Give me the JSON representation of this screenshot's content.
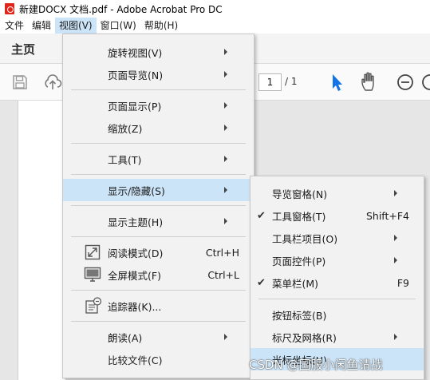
{
  "title_bar": {
    "title": "新建DOCX 文档.pdf - Adobe Acrobat Pro DC",
    "icon": "acrobat-pdf-icon"
  },
  "menubar": [
    {
      "label": "文件"
    },
    {
      "label": "编辑"
    },
    {
      "label": "视图(V)",
      "active": true
    },
    {
      "label": "窗口(W)"
    },
    {
      "label": "帮助(H)"
    }
  ],
  "tab": {
    "home": "主页"
  },
  "toolbar": {
    "page_current": "1",
    "page_total": "/ 1",
    "icons": [
      "save-icon",
      "upload-icon",
      "select-pointer-icon",
      "hand-tool-icon",
      "zoom-out-icon"
    ]
  },
  "view_menu": {
    "items": [
      {
        "label": "旋转视图(V)",
        "submenu": true
      },
      {
        "label": "页面导览(N)",
        "submenu": true
      },
      {
        "label": "页面显示(P)",
        "submenu": true
      },
      {
        "label": "缩放(Z)",
        "submenu": true
      },
      {
        "label": "工具(T)",
        "submenu": true
      },
      {
        "label": "显示/隐藏(S)",
        "submenu": true,
        "highlighted": true
      },
      {
        "label": "显示主题(H)",
        "submenu": true
      },
      {
        "label": "阅读模式(D)",
        "shortcut": "Ctrl+H",
        "icon": "read-mode-icon"
      },
      {
        "label": "全屏模式(F)",
        "shortcut": "Ctrl+L",
        "icon": "fullscreen-icon"
      },
      {
        "label": "追踪器(K)...",
        "icon": "tracker-icon"
      },
      {
        "label": "朗读(A)",
        "submenu": true
      },
      {
        "label": "比较文件(C)"
      }
    ]
  },
  "show_hide_menu": {
    "items": [
      {
        "label": "导览窗格(N)",
        "submenu": true
      },
      {
        "label": "工具窗格(T)",
        "shortcut": "Shift+F4",
        "checked": true
      },
      {
        "label": "工具栏项目(O)",
        "submenu": true
      },
      {
        "label": "页面控件(P)",
        "submenu": true
      },
      {
        "label": "菜单栏(M)",
        "shortcut": "F9",
        "checked": true
      },
      {
        "label": "按钮标签(B)"
      },
      {
        "label": "标尺及网格(R)",
        "submenu": true
      },
      {
        "label": "光标坐标(U)",
        "highlighted": true
      }
    ]
  },
  "watermark": "CSDN @国服小闲鱼请战",
  "colors": {
    "menu_highlight": "#cce4f7",
    "menu_bg": "#f2f2f2",
    "acrobat_red": "#e0261b",
    "toolbar_blue": "#1473e6"
  }
}
